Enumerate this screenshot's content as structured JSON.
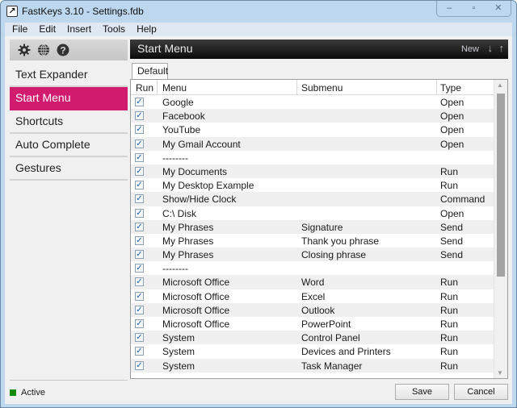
{
  "window": {
    "title": "FastKeys 3.10  - Settings.fdb",
    "controls": {
      "minimize": "‒",
      "maximize": "▫",
      "close": "✕"
    }
  },
  "menubar": [
    "File",
    "Edit",
    "Insert",
    "Tools",
    "Help"
  ],
  "toolbar_icons": [
    "gear-icon",
    "globe-icon",
    "help-icon"
  ],
  "sidebar": {
    "items": [
      {
        "label": "Text Expander",
        "active": false
      },
      {
        "label": "Start Menu",
        "active": true
      },
      {
        "label": "Shortcuts",
        "active": false
      },
      {
        "label": "Auto Complete",
        "active": false
      },
      {
        "label": "Gestures",
        "active": false
      }
    ]
  },
  "header": {
    "title": "Start Menu",
    "new_label": "New",
    "down_arrow": "↓",
    "up_arrow": "↑"
  },
  "tabs": [
    {
      "label": "Default",
      "active": true
    }
  ],
  "table": {
    "columns": [
      "Run",
      "Menu",
      "Submenu",
      "Type"
    ],
    "rows": [
      {
        "run": true,
        "menu": "Google",
        "submenu": "",
        "type": "Open"
      },
      {
        "run": true,
        "menu": "Facebook",
        "submenu": "",
        "type": "Open"
      },
      {
        "run": true,
        "menu": "YouTube",
        "submenu": "",
        "type": "Open"
      },
      {
        "run": true,
        "menu": "My Gmail Account",
        "submenu": "",
        "type": "Open"
      },
      {
        "run": true,
        "menu": "--------",
        "submenu": "",
        "type": ""
      },
      {
        "run": true,
        "menu": "My Documents",
        "submenu": "",
        "type": "Run"
      },
      {
        "run": true,
        "menu": "My Desktop Example",
        "submenu": "",
        "type": "Run"
      },
      {
        "run": true,
        "menu": "Show/Hide Clock",
        "submenu": "",
        "type": "Command"
      },
      {
        "run": true,
        "menu": "C:\\ Disk",
        "submenu": "",
        "type": "Open"
      },
      {
        "run": true,
        "menu": "My Phrases",
        "submenu": "Signature",
        "type": "Send"
      },
      {
        "run": true,
        "menu": "My Phrases",
        "submenu": "Thank you phrase",
        "type": "Send"
      },
      {
        "run": true,
        "menu": "My Phrases",
        "submenu": "Closing phrase",
        "type": "Send"
      },
      {
        "run": true,
        "menu": "--------",
        "submenu": "",
        "type": ""
      },
      {
        "run": true,
        "menu": "Microsoft Office",
        "submenu": "Word",
        "type": "Run"
      },
      {
        "run": true,
        "menu": "Microsoft Office",
        "submenu": "Excel",
        "type": "Run"
      },
      {
        "run": true,
        "menu": "Microsoft Office",
        "submenu": "Outlook",
        "type": "Run"
      },
      {
        "run": true,
        "menu": "Microsoft Office",
        "submenu": "PowerPoint",
        "type": "Run"
      },
      {
        "run": true,
        "menu": "System",
        "submenu": "Control Panel",
        "type": "Run"
      },
      {
        "run": true,
        "menu": "System",
        "submenu": "Devices and Printers",
        "type": "Run"
      },
      {
        "run": true,
        "menu": "System",
        "submenu": "Task Manager",
        "type": "Run"
      }
    ]
  },
  "status": {
    "label": "Active",
    "color": "#138a13"
  },
  "buttons": {
    "save": "Save",
    "cancel": "Cancel"
  },
  "colors": {
    "accent": "#d01b6e",
    "header_bg": "#1e1e1e",
    "frame": "#bcd7ee"
  }
}
